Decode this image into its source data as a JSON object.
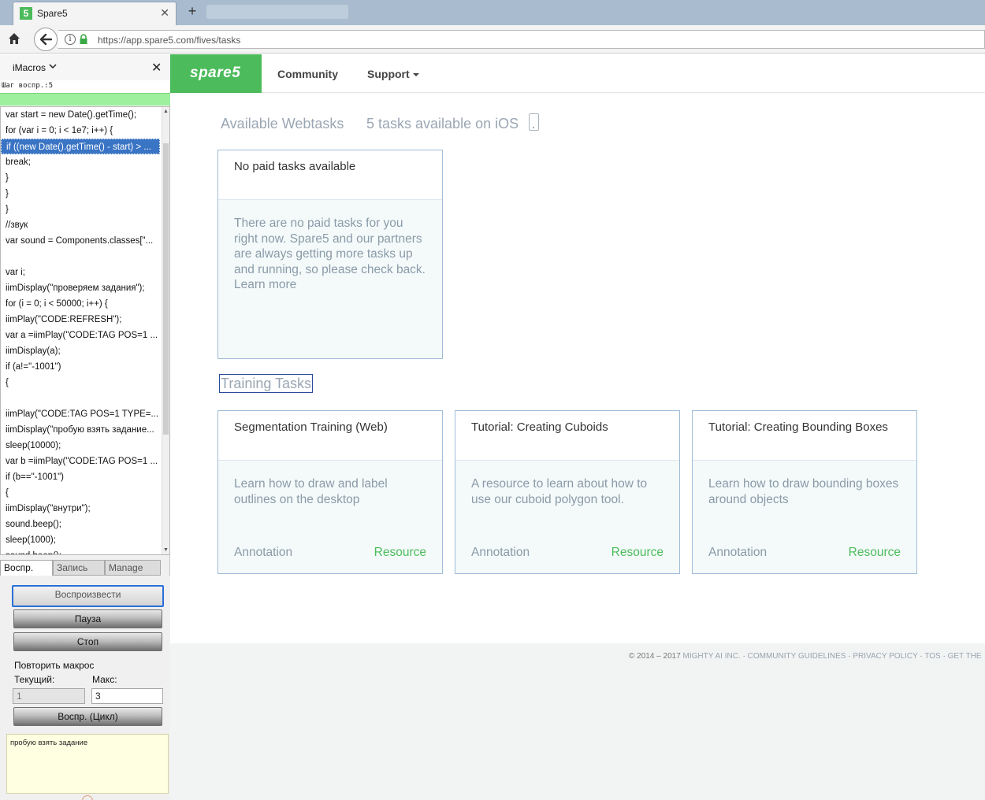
{
  "browser": {
    "tab_title": "Spare5",
    "tab_favicon": "5",
    "url": "https://app.spare5.com/fives/tasks"
  },
  "imacros": {
    "title": "iMacros",
    "step_text": "Шаг воспр.:5",
    "code_lines": [
      "var start = new Date().getTime();",
      "for (var i = 0; i < 1e7; i++) {",
      "if ((new Date().getTime() - start) > ...",
      "break;",
      "}",
      "}",
      "}",
      "//звук",
      "var sound = Components.classes[\"...",
      "",
      "var i;",
      "iimDisplay(\"проверяем задания\");",
      "for (i = 0; i < 50000; i++) {",
      "iimPlay(\"CODE:REFRESH\");",
      "var a =iimPlay(\"CODE:TAG POS=1 ...",
      "iimDisplay(a);",
      "if (a!=\"-1001\")",
      "{",
      "",
      "iimPlay(\"CODE:TAG POS=1 TYPE=...",
      "iimDisplay(\"пробую взять задание...",
      "sleep(10000);",
      "var b =iimPlay(\"CODE:TAG POS=1 ...",
      "if (b==\"-1001\")",
      "{",
      "iimDisplay(\"внутри\");",
      "sound.beep();",
      "sleep(1000);",
      "sound.beep();"
    ],
    "selected_line": 2,
    "tabs": [
      "Воспр.",
      "Запись",
      "Manage"
    ],
    "buttons": {
      "play": "Воспроизвести",
      "pause": "Пауза",
      "stop": "Стоп",
      "loop": "Воспр. (Цикл)"
    },
    "repeat_label": "Повторить макрос",
    "current_label": "Текущий:",
    "max_label": "Макс:",
    "current_value": "1",
    "max_value": "3",
    "status_text": "пробую взять задание"
  },
  "site": {
    "logo": "spare5",
    "nav": {
      "community": "Community",
      "support": "Support"
    },
    "available_heading": "Available Webtasks",
    "ios_heading": "5 tasks available on iOS",
    "paid_card": {
      "title": "No paid tasks available",
      "body": "There are no paid tasks for you right now. Spare5 and our partners are always getting more tasks up and running, so please check back.",
      "link": "Learn more"
    },
    "training_heading": "Training Tasks",
    "training_cards": [
      {
        "title": "Segmentation Training (Web)",
        "body": "Learn how to draw and label outlines on the desktop",
        "type": "Annotation",
        "resource": "Resource"
      },
      {
        "title": "Tutorial: Creating Cuboids",
        "body": "A resource to learn about how to use our cuboid polygon tool.",
        "type": "Annotation",
        "resource": "Resource"
      },
      {
        "title": "Tutorial: Creating Bounding Boxes",
        "body": "Learn how to draw bounding boxes around objects",
        "type": "Annotation",
        "resource": "Resource"
      }
    ],
    "footer": {
      "copyright": "© 2014 – 2017 ",
      "company": "MIGHTY AI INC.",
      "guidelines": "COMMUNITY GUIDELINES",
      "privacy": "PRIVACY POLICY",
      "tos": "TOS",
      "get": "GET THE"
    }
  },
  "colors": {
    "brand_green": "#4cbb5b",
    "card_border": "#9fbcd8",
    "muted_text": "#8a9aa8"
  }
}
